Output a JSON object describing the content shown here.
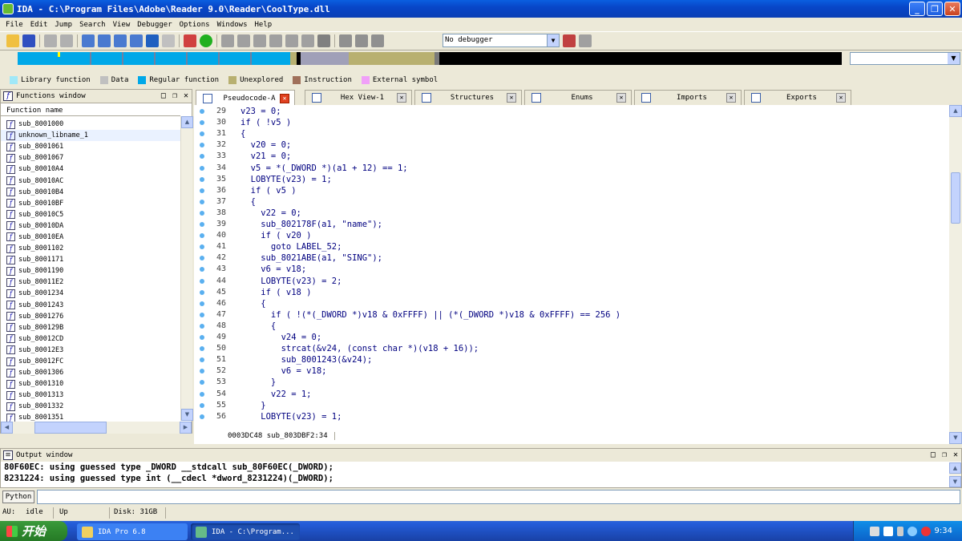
{
  "window": {
    "title": "IDA - C:\\Program Files\\Adobe\\Reader 9.0\\Reader\\CoolType.dll"
  },
  "menu": [
    "File",
    "Edit",
    "Jump",
    "Search",
    "View",
    "Debugger",
    "Options",
    "Windows",
    "Help"
  ],
  "toolbar": {
    "debugger_select": "No debugger"
  },
  "legend": [
    {
      "label": "Library function",
      "color": "#a0e8f8"
    },
    {
      "label": "Data",
      "color": "#c0c0c0"
    },
    {
      "label": "Regular function",
      "color": "#00a8e8"
    },
    {
      "label": "Unexplored",
      "color": "#b8b070"
    },
    {
      "label": "Instruction",
      "color": "#a0705a"
    },
    {
      "label": "External symbol",
      "color": "#f0a0f8"
    }
  ],
  "functions_window": {
    "title": "Functions window",
    "column": "Function name",
    "items": [
      "sub_8001000",
      "unknown_libname_1",
      "sub_8001061",
      "sub_8001067",
      "sub_80010A4",
      "sub_80010AC",
      "sub_80010B4",
      "sub_80010BF",
      "sub_80010C5",
      "sub_80010DA",
      "sub_80010EA",
      "sub_8001102",
      "sub_8001171",
      "sub_8001190",
      "sub_80011E2",
      "sub_8001234",
      "sub_8001243",
      "sub_8001276",
      "sub_800129B",
      "sub_80012CD",
      "sub_80012E3",
      "sub_80012FC",
      "sub_8001306",
      "sub_8001310",
      "sub_8001313",
      "sub_8001332",
      "sub_8001351"
    ],
    "selected_index": 1
  },
  "tabs": [
    {
      "label": "Pseudocode-A",
      "active": true
    },
    {
      "label": "Hex View-1",
      "active": false
    },
    {
      "label": "Structures",
      "active": false
    },
    {
      "label": "Enums",
      "active": false
    },
    {
      "label": "Imports",
      "active": false
    },
    {
      "label": "Exports",
      "active": false
    }
  ],
  "code": [
    {
      "n": "29",
      "t": "v23 = 0;"
    },
    {
      "n": "30",
      "t": "if ( !v5 )"
    },
    {
      "n": "31",
      "t": "{"
    },
    {
      "n": "32",
      "t": "  v20 = 0;"
    },
    {
      "n": "33",
      "t": "  v21 = 0;"
    },
    {
      "n": "34",
      "t": "  v5 = *(_DWORD *)(a1 + 12) == 1;"
    },
    {
      "n": "35",
      "t": "  LOBYTE(v23) = 1;"
    },
    {
      "n": "36",
      "t": "  if ( v5 )"
    },
    {
      "n": "37",
      "t": "  {"
    },
    {
      "n": "38",
      "t": "    v22 = 0;"
    },
    {
      "n": "39",
      "t": "    sub_802178F(a1, \"name\");"
    },
    {
      "n": "40",
      "t": "    if ( v20 )"
    },
    {
      "n": "41",
      "t": "      goto LABEL_52;"
    },
    {
      "n": "42",
      "t": "    sub_8021ABE(a1, \"SING\");"
    },
    {
      "n": "43",
      "t": "    v6 = v18;"
    },
    {
      "n": "44",
      "t": "    LOBYTE(v23) = 2;"
    },
    {
      "n": "45",
      "t": "    if ( v18 )"
    },
    {
      "n": "46",
      "t": "    {"
    },
    {
      "n": "47",
      "t": "      if ( !(*(_DWORD *)v18 & 0xFFFF) || (*(_DWORD *)v18 & 0xFFFF) == 256 )"
    },
    {
      "n": "48",
      "t": "      {"
    },
    {
      "n": "49",
      "t": "        v24 = 0;"
    },
    {
      "n": "50",
      "t": "        strcat(&v24, (const char *)(v18 + 16));"
    },
    {
      "n": "51",
      "t": "        sub_8001243(&v24);"
    },
    {
      "n": "52",
      "t": "        v6 = v18;"
    },
    {
      "n": "53",
      "t": "      }"
    },
    {
      "n": "54",
      "t": "      v22 = 1;"
    },
    {
      "n": "55",
      "t": "    }"
    },
    {
      "n": "56",
      "t": "    LOBYTE(v23) = 1;"
    }
  ],
  "code_status": "0003DC48 sub_803DBF2:34",
  "output_window": {
    "title": "Output window",
    "lines": [
      "80F60EC: using guessed type _DWORD __stdcall sub_80F60EC(_DWORD);",
      "8231224: using guessed type int (__cdecl *dword_8231224)(_DWORD);"
    ]
  },
  "python_button": "Python",
  "status": {
    "au_label": "AU:",
    "au_state": "idle",
    "direction": "Up",
    "disk": "Disk: 31GB"
  },
  "taskbar": {
    "start": "开始",
    "tasks": [
      "IDA Pro 6.8",
      "IDA - C:\\Program..."
    ],
    "clock": "9:34"
  }
}
